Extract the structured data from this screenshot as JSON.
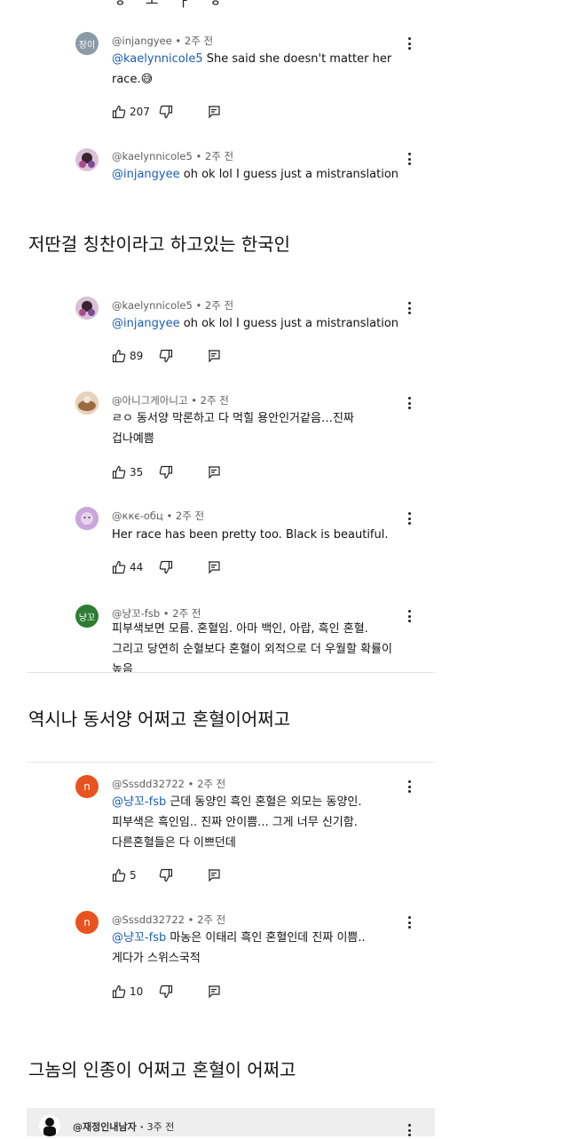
{
  "top_fragment": "ㅎ ㅗ ㅏ ㅎ",
  "comments": [
    {
      "handle": "@injangyee",
      "time": "2주 전",
      "avatar_text": "장이",
      "body_prefix": "",
      "mention": "@kaelynnicole5",
      "body": " She said she doesn't matter her",
      "body2": "race.😅",
      "likes": "207"
    },
    {
      "handle": "@kaelynnicole5",
      "time": "2주 전",
      "avatar_text": "",
      "mention": "@injangyee",
      "body": "  oh ok lol I guess just a mistranslation"
    },
    {
      "handle": "@kaelynnicole5",
      "time": "2주 전",
      "avatar_text": "",
      "mention": "@injangyee",
      "body": "  oh ok lol I guess just a mistranslation",
      "likes": "89"
    },
    {
      "handle": "@아니그게아니고",
      "time": "2주 전",
      "avatar_text": "",
      "body": "ㄹㅇ 동서양 막론하고 다 먹힐 용안인거같음…진짜",
      "body2": "겁나예쁨",
      "likes": "35"
    },
    {
      "handle": "@ккє-обц",
      "time": "2주 전",
      "avatar_text": "",
      "body": "Her race has been pretty too. Black is beautiful.",
      "likes": "44"
    },
    {
      "handle": "@냥꼬-fsb",
      "time": "2주 전",
      "avatar_text": "냥꼬",
      "body": "피부색보면 모름. 혼혈임. 아마 백인, 아랍, 흑인 혼혈.",
      "body2": "그리고 당연히 순혈보다 혼혈이 외적으로 더 우월할 확률이",
      "body3": "높음"
    },
    {
      "handle": "@Sssdd32722",
      "time": "2주 전",
      "avatar_text": "n",
      "mention": "@냥꼬-fsb",
      "body": " 근데 동양인 흑인 혼혈은 외모는 동양인.",
      "body2": "피부색은 흑인임.. 진짜 안이쁨... 그게 너무 신기함.",
      "body3": "다른혼혈들은 다 이쁘던데",
      "likes": "5"
    },
    {
      "handle": "@Sssdd32722",
      "time": "2주 전",
      "avatar_text": "n",
      "mention": "@냥꼬-fsb",
      "body": " 마농은 이태리 흑인 혼혈인데 진짜 이쁨..",
      "body2": "게다가 스위스국적",
      "likes": "10"
    },
    {
      "handle": "@재정인내남자",
      "time": "3주 전",
      "avatar_text": ""
    }
  ],
  "captions": {
    "first": "저딴걸 칭찬이라고 하고있는 한국인",
    "second": "역시나 동서양 어쩌고 혼혈이어쩌고",
    "third": "그놈의 인종이 어쩌고 혼혈이 어쩌고"
  },
  "colors": {
    "mention": "#1a5fb4",
    "meta": "#606060",
    "orange_avatar": "#e8531f",
    "green_avatar": "#2e7d32",
    "gray_avatar": "#8a9aa6"
  },
  "icons": [
    "thumbs-up-icon",
    "thumbs-down-icon",
    "reply-icon",
    "more-vert-icon"
  ]
}
